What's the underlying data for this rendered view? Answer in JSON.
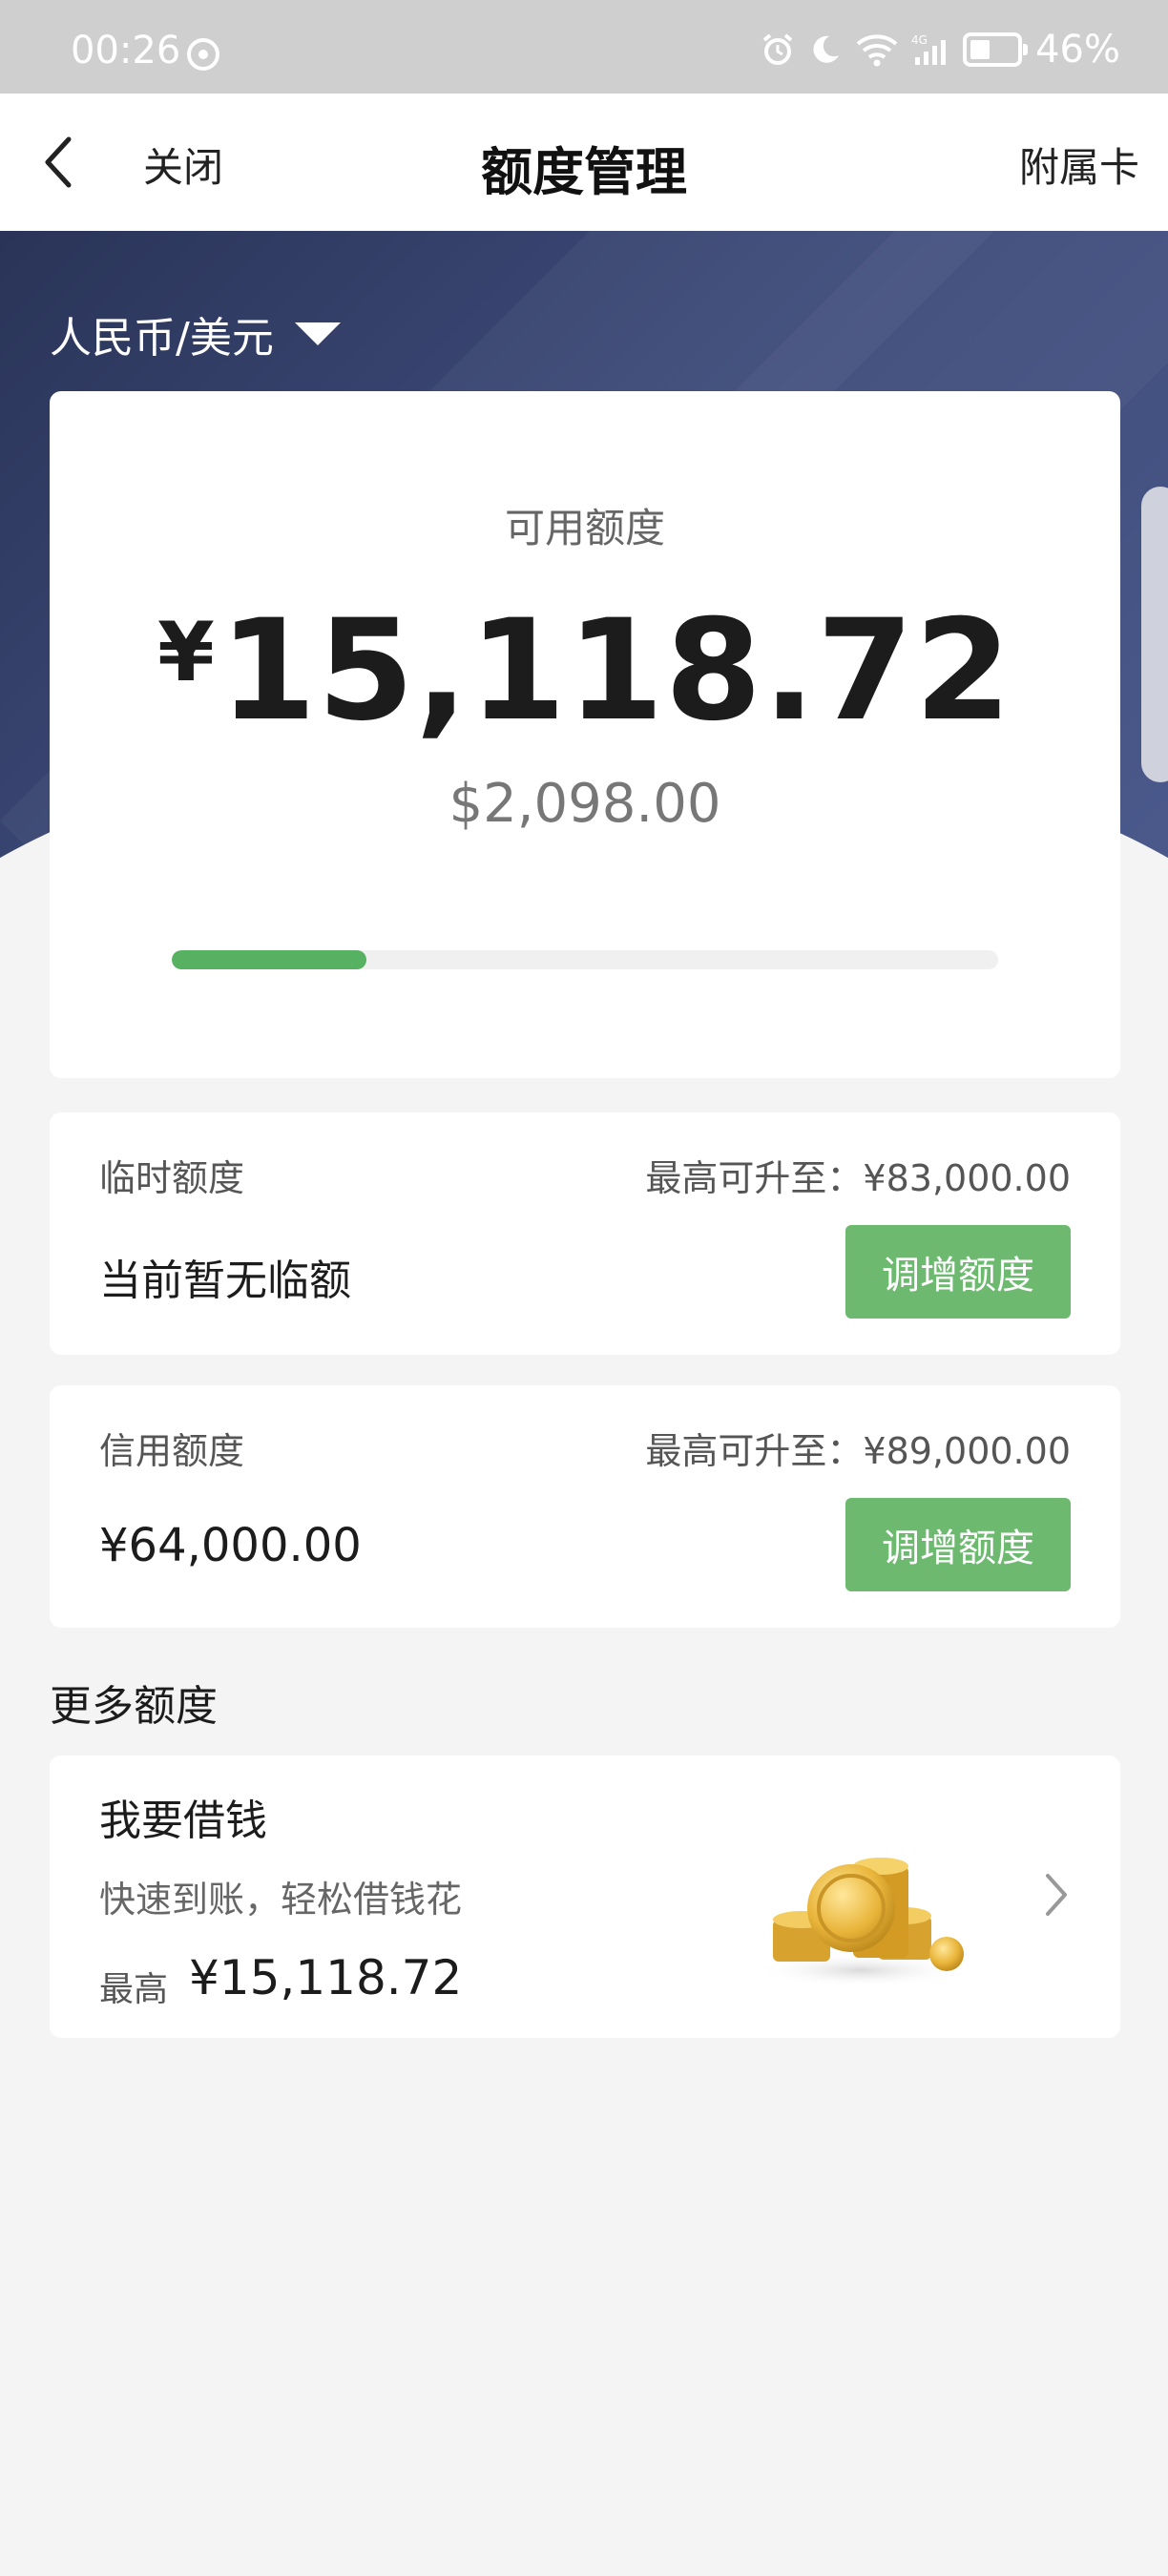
{
  "status_bar": {
    "time": "00:26",
    "network": "4G",
    "battery_percent": "46%",
    "battery_level": 0.46
  },
  "nav": {
    "back_label": "关闭",
    "title": "额度管理",
    "right_action": "附属卡"
  },
  "currency_switch": {
    "label": "人民币/美元"
  },
  "available": {
    "label": "可用额度",
    "currency_symbol": "¥",
    "cny_amount": "15,118.72",
    "usd_amount": "$2,098.00",
    "progress_fraction": 0.236,
    "progress_color": "#56b160"
  },
  "temporary_limit": {
    "title": "临时额度",
    "max_text": "最高可升至：¥83,000.00",
    "value": "当前暂无临额",
    "button_label": "调增额度"
  },
  "credit_limit": {
    "title": "信用额度",
    "max_text": "最高可升至：¥89,000.00",
    "value": "¥64,000.00",
    "button_label": "调增额度"
  },
  "more": {
    "heading": "更多额度",
    "loan": {
      "title": "我要借钱",
      "subtitle": "快速到账，轻松借钱花",
      "max_label": "最高",
      "max_value": "¥15,118.72"
    }
  },
  "colors": {
    "hero_dark": "#2a3458",
    "hero_light": "#4b5a8c",
    "button_green": "#6cb96f",
    "background": "#f4f4f4"
  }
}
